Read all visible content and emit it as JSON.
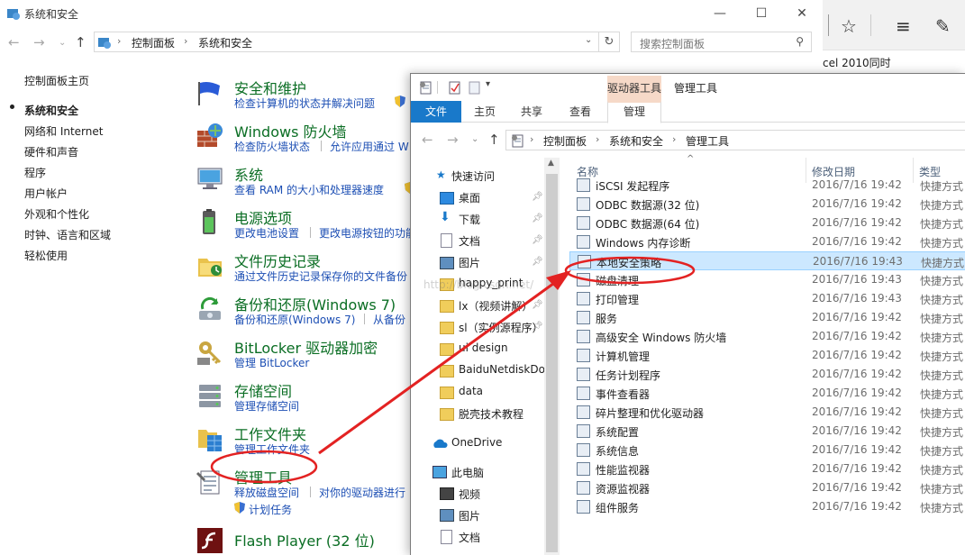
{
  "cp": {
    "title": "系统和安全",
    "breadcrumb": [
      "控制面板",
      "系统和安全"
    ],
    "search_placeholder": "搜索控制面板",
    "left_nav": [
      "控制面板主页",
      "系统和安全",
      "网络和 Internet",
      "硬件和声音",
      "程序",
      "用户帐户",
      "外观和个性化",
      "时钟、语言和区域",
      "轻松使用"
    ],
    "categories": [
      {
        "title": "安全和维护",
        "links": [
          "检查计算机的状态并解决问题"
        ]
      },
      {
        "title": "Windows 防火墙",
        "links": [
          "检查防火墙状态",
          "允许应用通过 W"
        ]
      },
      {
        "title": "系统",
        "links": [
          "查看 RAM 的大小和处理器速度"
        ]
      },
      {
        "title": "电源选项",
        "links": [
          "更改电池设置",
          "更改电源按钮的功能"
        ]
      },
      {
        "title": "文件历史记录",
        "links": [
          "通过文件历史记录保存你的文件备份"
        ]
      },
      {
        "title": "备份和还原(Windows 7)",
        "links": [
          "备份和还原(Windows 7)",
          "从备份"
        ]
      },
      {
        "title": "BitLocker 驱动器加密",
        "links": [
          "管理 BitLocker"
        ]
      },
      {
        "title": "存储空间",
        "links": [
          "管理存储空间"
        ]
      },
      {
        "title": "工作文件夹",
        "links": [
          "管理工作文件夹"
        ]
      },
      {
        "title": "管理工具",
        "links": [
          "释放磁盘空间",
          "对你的驱动器进行",
          "计划任务"
        ]
      },
      {
        "title": "Flash Player (32 位)",
        "links": []
      }
    ]
  },
  "browser": {
    "fragment_text": "cel 2010同时"
  },
  "explorer": {
    "context_tab": "驱动器工具",
    "context_title": "管理工具",
    "ribbon_tabs": [
      "文件",
      "主页",
      "共享",
      "查看",
      "管理"
    ],
    "breadcrumb": [
      "控制面板",
      "系统和安全",
      "管理工具"
    ],
    "nav_items": [
      {
        "label": "快速访问",
        "pinned": false
      },
      {
        "label": "桌面",
        "pinned": true
      },
      {
        "label": "下载",
        "pinned": true
      },
      {
        "label": "文档",
        "pinned": true
      },
      {
        "label": "图片",
        "pinned": true
      },
      {
        "label": "happy_print",
        "pinned": false
      },
      {
        "label": "lx（视频讲解）",
        "pinned": true
      },
      {
        "label": "sl（实例源程序）",
        "pinned": true
      },
      {
        "label": "ui design",
        "pinned": false
      },
      {
        "label": "BaiduNetdiskDo",
        "pinned": false
      },
      {
        "label": "data",
        "pinned": false
      },
      {
        "label": "脱壳技术教程",
        "pinned": false
      },
      {
        "label": "OneDrive",
        "pinned": false
      },
      {
        "label": "此电脑",
        "pinned": false
      },
      {
        "label": "视频",
        "pinned": false
      },
      {
        "label": "图片",
        "pinned": false
      },
      {
        "label": "文档",
        "pinned": false
      }
    ],
    "columns": [
      "名称",
      "修改日期",
      "类型"
    ],
    "files": [
      {
        "name": "iSCSI 发起程序",
        "date": "2016/7/16 19:42",
        "type": "快捷方式"
      },
      {
        "name": "ODBC 数据源(32 位)",
        "date": "2016/7/16 19:42",
        "type": "快捷方式"
      },
      {
        "name": "ODBC 数据源(64 位)",
        "date": "2016/7/16 19:42",
        "type": "快捷方式"
      },
      {
        "name": "Windows 内存诊断",
        "date": "2016/7/16 19:42",
        "type": "快捷方式"
      },
      {
        "name": "本地安全策略",
        "date": "2016/7/16 19:43",
        "type": "快捷方式"
      },
      {
        "name": "磁盘清理",
        "date": "2016/7/16 19:43",
        "type": "快捷方式"
      },
      {
        "name": "打印管理",
        "date": "2016/7/16 19:43",
        "type": "快捷方式"
      },
      {
        "name": "服务",
        "date": "2016/7/16 19:42",
        "type": "快捷方式"
      },
      {
        "name": "高级安全 Windows 防火墙",
        "date": "2016/7/16 19:42",
        "type": "快捷方式"
      },
      {
        "name": "计算机管理",
        "date": "2016/7/16 19:42",
        "type": "快捷方式"
      },
      {
        "name": "任务计划程序",
        "date": "2016/7/16 19:42",
        "type": "快捷方式"
      },
      {
        "name": "事件查看器",
        "date": "2016/7/16 19:42",
        "type": "快捷方式"
      },
      {
        "name": "碎片整理和优化驱动器",
        "date": "2016/7/16 19:42",
        "type": "快捷方式"
      },
      {
        "name": "系统配置",
        "date": "2016/7/16 19:42",
        "type": "快捷方式"
      },
      {
        "name": "系统信息",
        "date": "2016/7/16 19:42",
        "type": "快捷方式"
      },
      {
        "name": "性能监视器",
        "date": "2016/7/16 19:42",
        "type": "快捷方式"
      },
      {
        "name": "资源监视器",
        "date": "2016/7/16 19:42",
        "type": "快捷方式"
      },
      {
        "name": "组件服务",
        "date": "2016/7/16 19:42",
        "type": "快捷方式"
      }
    ]
  },
  "colors": {
    "accent": "#1979ca",
    "link": "#1d4fb4",
    "category": "#0b6e24",
    "annotation": "#e32222",
    "selection": "#cce8ff"
  }
}
